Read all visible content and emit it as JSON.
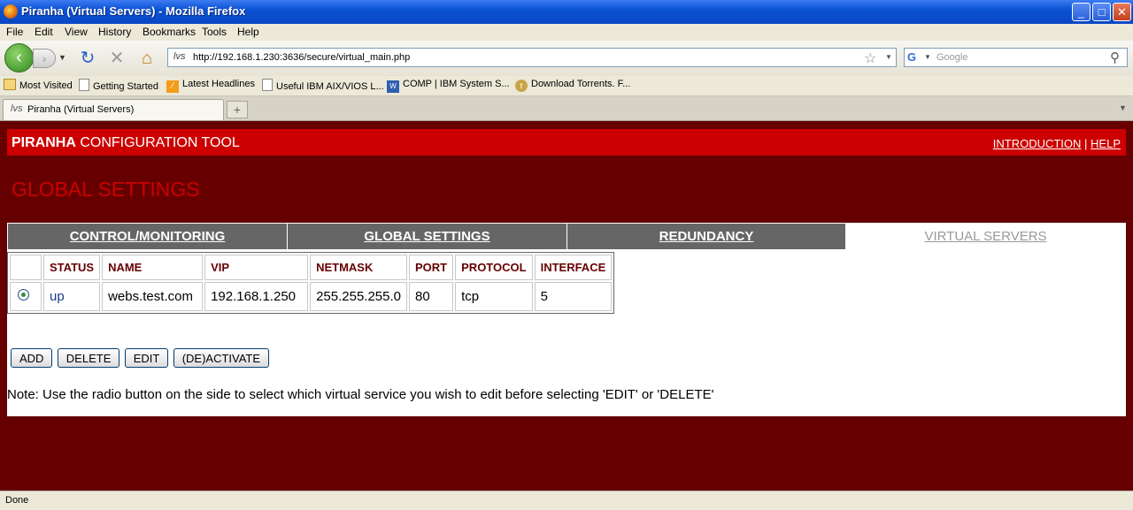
{
  "window": {
    "title": "Piranha (Virtual Servers) - Mozilla Firefox",
    "minimize": "_",
    "maximize": "□",
    "close": "✕"
  },
  "menu": {
    "items": [
      "File",
      "Edit",
      "View",
      "History",
      "Bookmarks",
      "Tools",
      "Help"
    ]
  },
  "nav": {
    "url": "http://192.168.1.230:3636/secure/virtual_main.php",
    "search_placeholder": "Google"
  },
  "bookmarks": {
    "items": [
      "Most Visited",
      "Getting Started",
      "Latest Headlines",
      "Useful IBM AIX/VIOS L...",
      "COMP | IBM System S...",
      "Download Torrents. F..."
    ]
  },
  "tabs": {
    "active_label": "Piranha (Virtual Servers)"
  },
  "app": {
    "brand_bold": "PIRANHA",
    "brand_rest": " CONFIGURATION TOOL",
    "link_intro": "INTRODUCTION",
    "link_sep": " | ",
    "link_help": "HELP",
    "page_title": "GLOBAL SETTINGS",
    "nav_tabs": [
      {
        "label": "CONTROL/MONITORING",
        "active": false
      },
      {
        "label": "GLOBAL SETTINGS",
        "active": false
      },
      {
        "label": "REDUNDANCY",
        "active": false
      },
      {
        "label": "VIRTUAL SERVERS",
        "active": true
      }
    ],
    "table": {
      "headers": [
        "STATUS",
        "NAME",
        "VIP",
        "NETMASK",
        "PORT",
        "PROTOCOL",
        "INTERFACE"
      ],
      "rows": [
        {
          "selected": true,
          "status": "up",
          "name": "webs.test.com",
          "vip": "192.168.1.250",
          "netmask": "255.255.255.0",
          "port": "80",
          "protocol": "tcp",
          "interface": "5"
        }
      ]
    },
    "buttons": {
      "add": "ADD",
      "delete": "DELETE",
      "edit": "EDIT",
      "deactivate": "(DE)ACTIVATE"
    },
    "note": "Note: Use the radio button on the side to select which virtual service you wish to edit before selecting 'EDIT' or 'DELETE'"
  },
  "status": {
    "text": "Done"
  },
  "colors": {
    "background": "#660000",
    "header_band": "#cc0000",
    "tab_inactive": "#666666",
    "column_header_text": "#660000"
  }
}
